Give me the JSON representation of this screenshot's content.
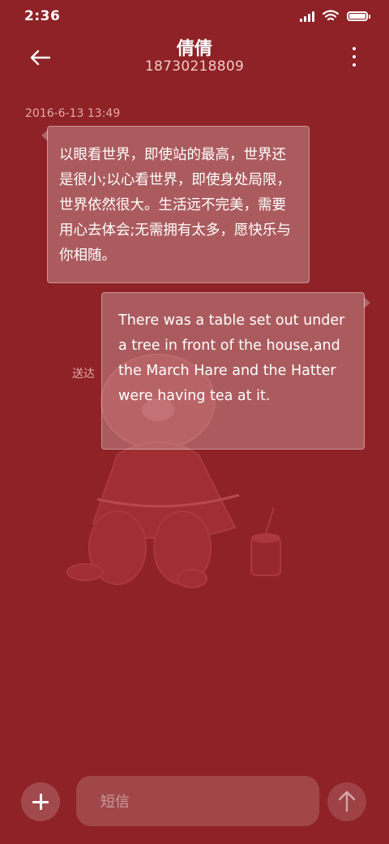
{
  "status_bar": {
    "time": "2:36",
    "icons": [
      "signal-icon",
      "wifi-icon",
      "battery-icon"
    ]
  },
  "header": {
    "contact_name": "倩倩",
    "phone_number": "18730218809",
    "icons": [
      "back-arrow-icon",
      "more-vert-icon"
    ]
  },
  "conversation": {
    "timestamp": "2016-6-13 13:49",
    "incoming_message": "以眼看世界，即使站的最高，世界还是很小;以心看世界，即使身处局限，世界依然很大。生活远不完美，需要用心去体会;无需拥有太多，愿快乐与你相随。",
    "outgoing_message": "There was a table set out under a tree in front of the house,and the March Hare and the Hatter were having tea at it.",
    "outgoing_status": "送达"
  },
  "composer": {
    "placeholder": "短信",
    "value": "",
    "icons": [
      "plus-icon",
      "send-arrow-icon"
    ]
  },
  "colors": {
    "background": "#8e2226",
    "bubble": "rgba(255,255,255,0.26)",
    "muted_text": "#e6a9a9"
  }
}
